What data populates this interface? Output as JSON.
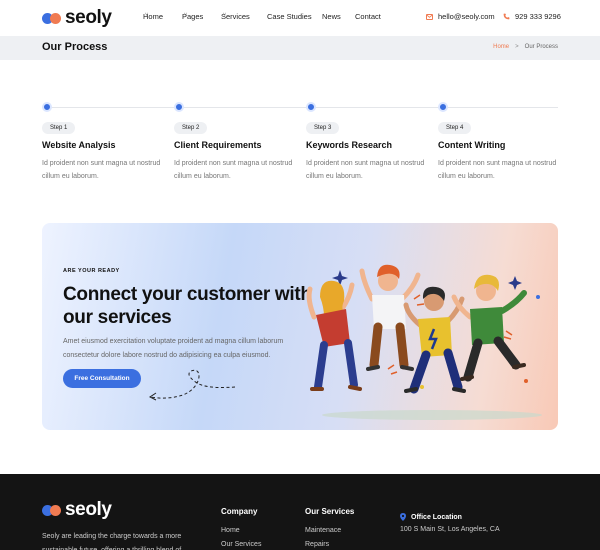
{
  "brand": {
    "name": "seoly",
    "colors": {
      "primary": "#3b6fe0",
      "accent": "#f07b52",
      "dark": "#141414"
    }
  },
  "nav": {
    "items": [
      {
        "label": "Home",
        "has_dropdown": true
      },
      {
        "label": "Pages",
        "has_dropdown": true
      },
      {
        "label": "Services",
        "has_dropdown": true
      },
      {
        "label": "Case Studies",
        "has_dropdown": false
      },
      {
        "label": "News",
        "has_dropdown": false
      },
      {
        "label": "Contact",
        "has_dropdown": false
      }
    ],
    "email": "hello@seoly.com",
    "phone": "929 333 9296",
    "dropdown_glyph": "˅"
  },
  "page_title": "Our Process",
  "breadcrumb": {
    "home": "Home",
    "separator": ">",
    "current": "Our Process"
  },
  "process": {
    "steps": [
      {
        "badge": "Step 1",
        "title": "Website Analysis",
        "desc": "Id proident non sunt magna ut nostrud cillum eu laborum."
      },
      {
        "badge": "Step 2",
        "title": "Client Requirements",
        "desc": "Id proident non sunt magna ut nostrud cillum eu laborum."
      },
      {
        "badge": "Step 3",
        "title": "Keywords Research",
        "desc": "Id proident non sunt magna ut nostrud cillum eu laborum."
      },
      {
        "badge": "Step 4",
        "title": "Content Writing",
        "desc": "Id proident non sunt magna ut nostrud cillum eu laborum."
      }
    ]
  },
  "cta": {
    "eyebrow": "ARE YOUR READY",
    "heading": "Connect your customer with our services",
    "description": "Amet eiusmod exercitation voluptate proident ad magna cillum laborum consectetur dolore labore nostrud do adipisicing ea culpa eiusmod.",
    "button": "Free Consultation"
  },
  "footer": {
    "about": "Seoly are leading the charge towards a more sustainable future, offering a thrilling blend of",
    "company": {
      "title": "Company",
      "links": [
        "Home",
        "Our Services"
      ]
    },
    "services": {
      "title": "Our Services",
      "links": [
        "Maintenace",
        "Repairs"
      ]
    },
    "office": {
      "title": "Office Location",
      "address": "100 S Main St, Los Angeles, CA"
    }
  }
}
